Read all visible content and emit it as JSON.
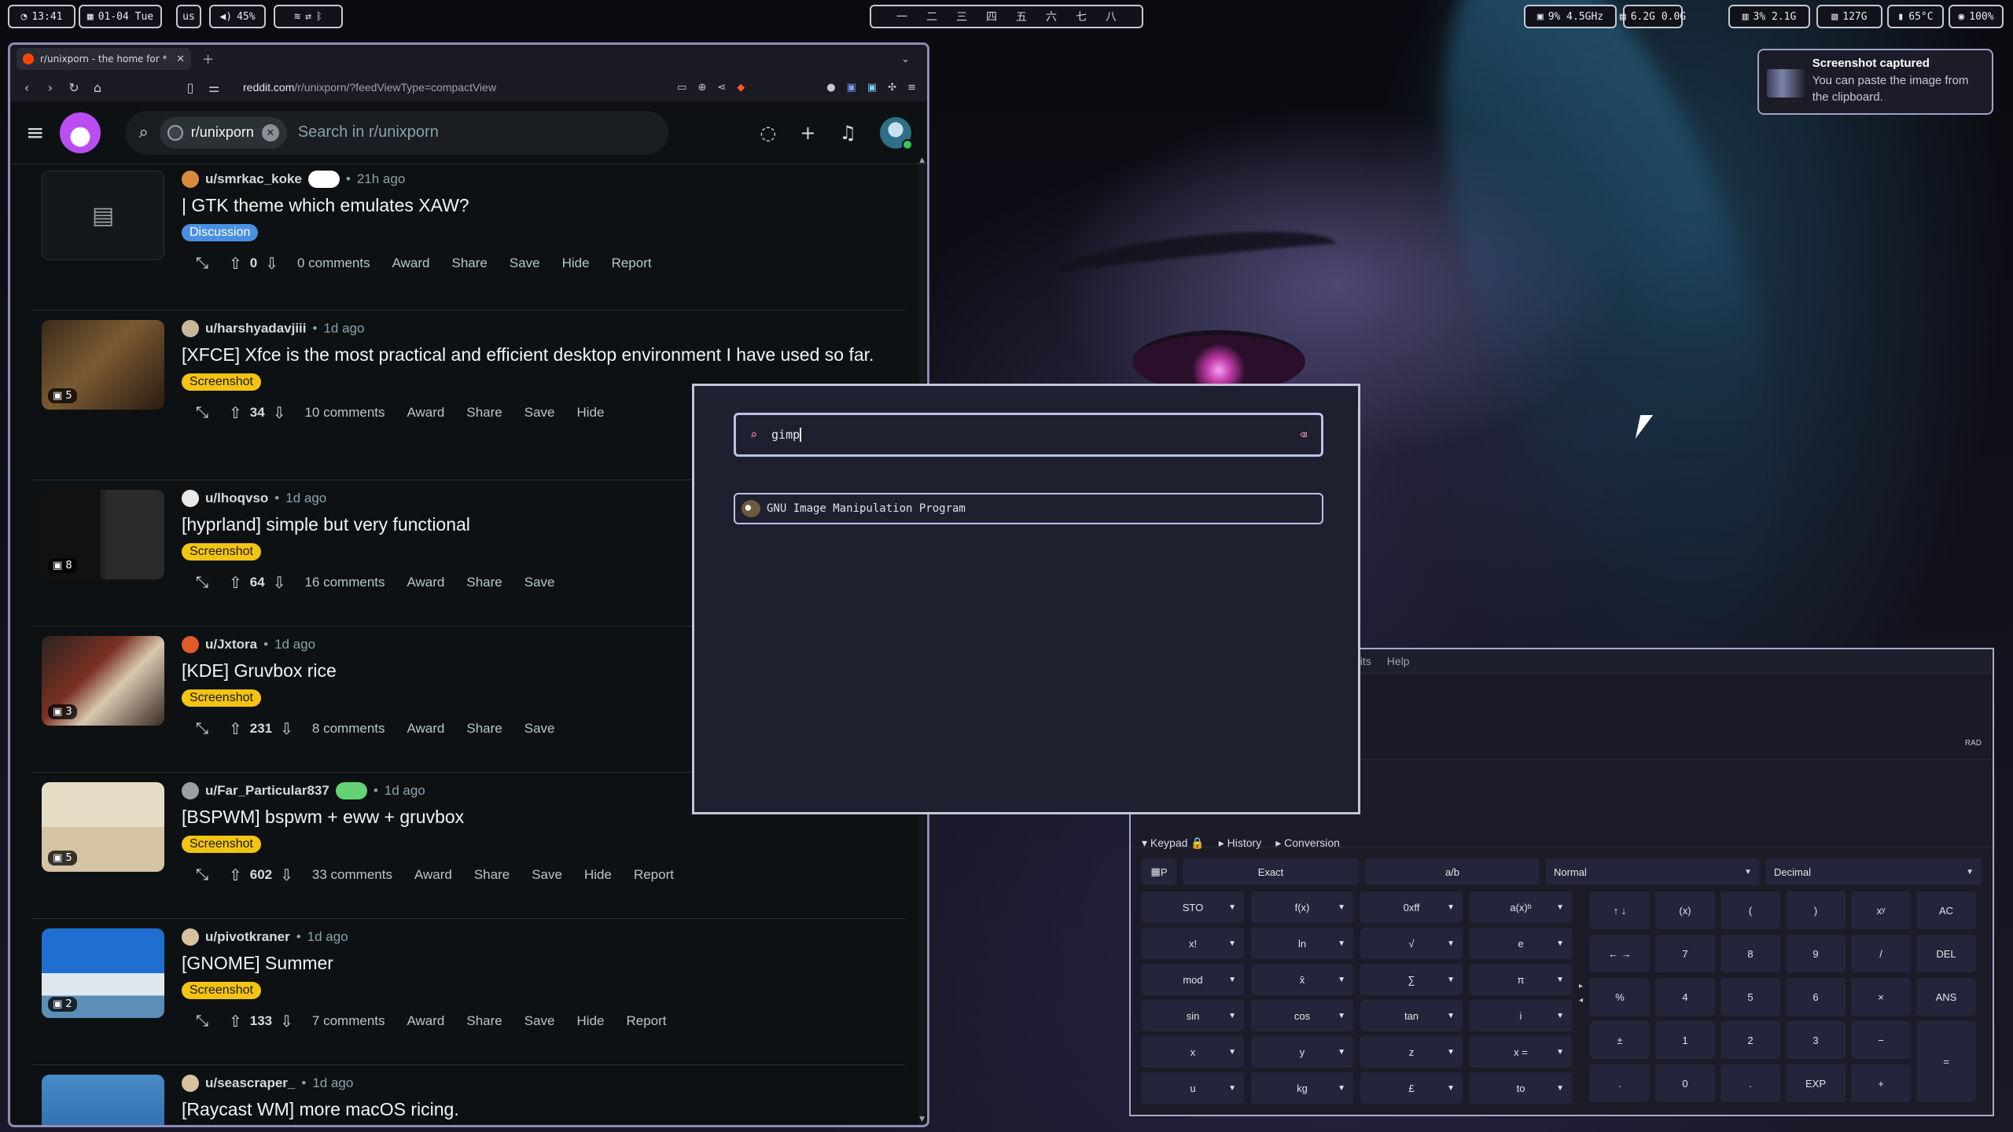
{
  "topbar": {
    "clock": "13:41",
    "date": "01-04 Tue",
    "layout": "us",
    "volume": "45%",
    "workspaces": [
      "一",
      "二",
      "三",
      "四",
      "五",
      "六",
      "七",
      "八"
    ],
    "cpu": "9% 4.5GHz",
    "mem": "6.2G 0.0G",
    "gpu": "3% 2.1G",
    "disk": "127G",
    "temp": "65°C",
    "battery": "100%"
  },
  "notification": {
    "title": "Screenshot captured",
    "body": "You can paste the image from the clipboard."
  },
  "browser": {
    "tab_title": "r/unixporn - the home for *",
    "url_host": "reddit.com",
    "url_path": "/r/unixporn/?feedViewType=compactView",
    "search_chip": "r/unixporn",
    "search_placeholder": "Search in r/unixporn"
  },
  "posts": [
    {
      "user": "u/smrkac_koke",
      "ago": "21h ago",
      "title": "| GTK theme which emulates XAW?",
      "flair": "Discussion",
      "score": "0",
      "comments": "0 comments",
      "thumb": null,
      "user_flair": "white"
    },
    {
      "user": "u/harshyadavjiii",
      "ago": "1d ago",
      "title": "[XFCE] Xfce is the most practical and efficient desktop environment I have used so far.",
      "flair": "Screenshot",
      "score": "34",
      "comments": "10 comments",
      "thumb": "5",
      "user_flair": null
    },
    {
      "user": "u/lhoqvso",
      "ago": "1d ago",
      "title": "[hyprland] simple but very functional",
      "flair": "Screenshot",
      "score": "64",
      "comments": "16 comments",
      "thumb": "8",
      "user_flair": null
    },
    {
      "user": "u/Jxtora",
      "ago": "1d ago",
      "title": "[KDE] Gruvbox rice",
      "flair": "Screenshot",
      "score": "231",
      "comments": "8 comments",
      "thumb": "3",
      "user_flair": null
    },
    {
      "user": "u/Far_Particular837",
      "ago": "1d ago",
      "title": "[BSPWM] bspwm + eww + gruvbox",
      "flair": "Screenshot",
      "score": "602",
      "comments": "33 comments",
      "thumb": "5",
      "user_flair": "green"
    },
    {
      "user": "u/pivotkraner",
      "ago": "1d ago",
      "title": "[GNOME] Summer",
      "flair": "Screenshot",
      "score": "133",
      "comments": "7 comments",
      "thumb": "2",
      "user_flair": null
    },
    {
      "user": "u/seascraper_",
      "ago": "1d ago",
      "title": "[Raycast WM] more macOS ricing.",
      "flair": null,
      "score": "",
      "comments": "",
      "thumb": "",
      "user_flair": null
    }
  ],
  "actions": {
    "award": "Award",
    "share": "Share",
    "save": "Save",
    "hide": "Hide",
    "report": "Report"
  },
  "launcher": {
    "query": "gimp",
    "result": "GNU Image Manipulation Program"
  },
  "calc": {
    "menu_units": "nits",
    "menu_help": "Help",
    "rad": "RAD",
    "sections": [
      "Keypad",
      "History",
      "Conversion"
    ],
    "row1": {
      "p": "P",
      "exact": "Exact",
      "frac": "a/b",
      "normal": "Normal",
      "decimal": "Decimal"
    },
    "fn_buttons": [
      "STO",
      "f(x)",
      "0xff",
      "a(x)ᵇ",
      "x!",
      "ln",
      "√",
      "e",
      "mod",
      "x̄",
      "∑",
      "π",
      "sin",
      "cos",
      "tan",
      "i",
      "x",
      "y",
      "z",
      "x =",
      "u",
      "kg",
      "£",
      "to"
    ],
    "num_buttons": [
      "↑ ↓",
      "(x)",
      "(",
      ")",
      "xʸ",
      "AC",
      "← →",
      "7",
      "8",
      "9",
      "/",
      "DEL",
      "%",
      "4",
      "5",
      "6",
      "×",
      "ANS",
      "±",
      "1",
      "2",
      "3",
      "−",
      "=",
      ".",
      "0",
      ".",
      "EXP",
      "+"
    ]
  }
}
